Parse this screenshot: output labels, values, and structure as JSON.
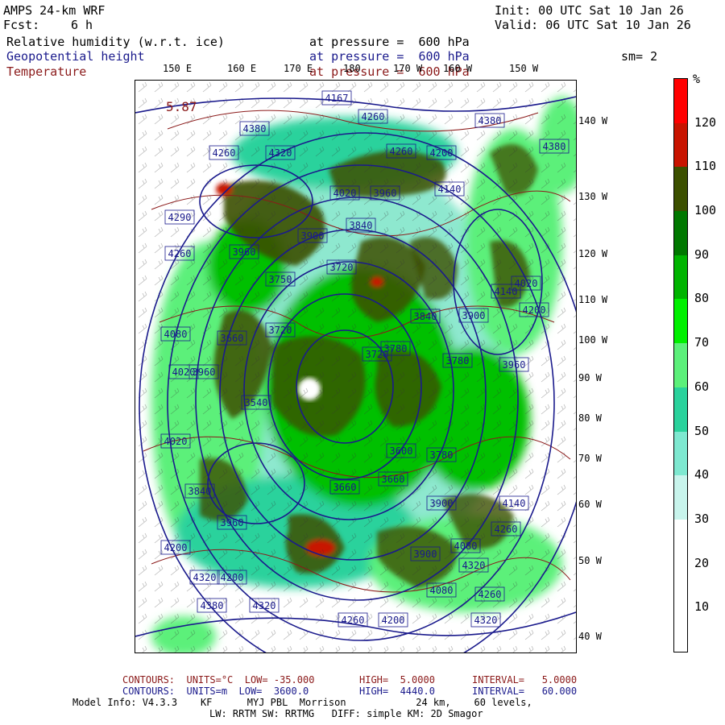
{
  "header": {
    "model": "AMPS 24-km WRF",
    "fcst_label": "Fcst:",
    "fcst_value": "6 h",
    "init": "Init: 00 UTC Sat 10 Jan 26",
    "valid": "Valid: 06 UTC Sat 10 Jan 26"
  },
  "fields": [
    {
      "name": "Relative humidity (w.r.t. ice)",
      "level": "at pressure =  600 hPa",
      "color": "#000000"
    },
    {
      "name": "Geopotential height",
      "level": "at pressure =  600 hPa",
      "color": "#1a1a8c"
    },
    {
      "name": "Temperature",
      "level": "at pressure =  600 hPa",
      "color": "#8b1a1a"
    }
  ],
  "smoothing": "sm= 2",
  "lon_labels": [
    "150 E",
    "160 E",
    "170 E",
    "180",
    "170 W",
    "160 W",
    "150 W"
  ],
  "lat_labels": [
    "140 W",
    "130 W",
    "120 W",
    "110 W",
    "100 W",
    "90 W",
    "80 W",
    "70 W",
    "60 W",
    "50 W",
    "40 W"
  ],
  "colorbar": {
    "unit": "%",
    "ticks": [
      "120",
      "110",
      "100",
      "90",
      "80",
      "70",
      "60",
      "50",
      "40",
      "30",
      "20",
      "10"
    ],
    "colors": [
      "#ff0000",
      "#c81400",
      "#3c5000",
      "#007800",
      "#00b400",
      "#00f000",
      "#5cf07a",
      "#2ad29c",
      "#7ee8d0",
      "#c8f4ec",
      "#ffffff",
      "#ffffff",
      "#ffffff"
    ]
  },
  "height_labels": [
    "4167",
    "4380",
    "4260",
    "4320",
    "4260",
    "4200",
    "4260",
    "4380",
    "4380",
    "4020",
    "3960",
    "4140",
    "4290",
    "3840",
    "3900",
    "3960",
    "4260",
    "4140",
    "3750",
    "3720",
    "4020",
    "4200",
    "4080",
    "3780",
    "3840",
    "3900",
    "3660",
    "3720",
    "4020",
    "3960",
    "3780",
    "3540",
    "3720",
    "3960",
    "4020",
    "3600",
    "3840",
    "3780",
    "3660",
    "3900",
    "3960",
    "4140",
    "4080",
    "3660",
    "4200",
    "3900",
    "4320",
    "4260",
    "4200",
    "4320",
    "4080",
    "4260",
    "4380",
    "4320",
    "4260",
    "4200",
    "4320"
  ],
  "temp_label": "5.87",
  "footer": {
    "line1_a": "CONTOURS:  UNITS=°C  LOW= -35.000",
    "line1_b": "HIGH=  5.0000",
    "line1_c": "INTERVAL=   5.0000",
    "line2_a": "CONTOURS:  UNITS=m  LOW=  3600.0",
    "line2_b": "HIGH=  4440.0",
    "line2_c": "INTERVAL=   60.000",
    "line3": "Model Info: V4.3.3    KF      MYJ PBL  Morrison            24 km,    60 levels,",
    "line4": "LW: RRTM SW: RRTMG   DIFF: simple KM: 2D Smagor"
  }
}
